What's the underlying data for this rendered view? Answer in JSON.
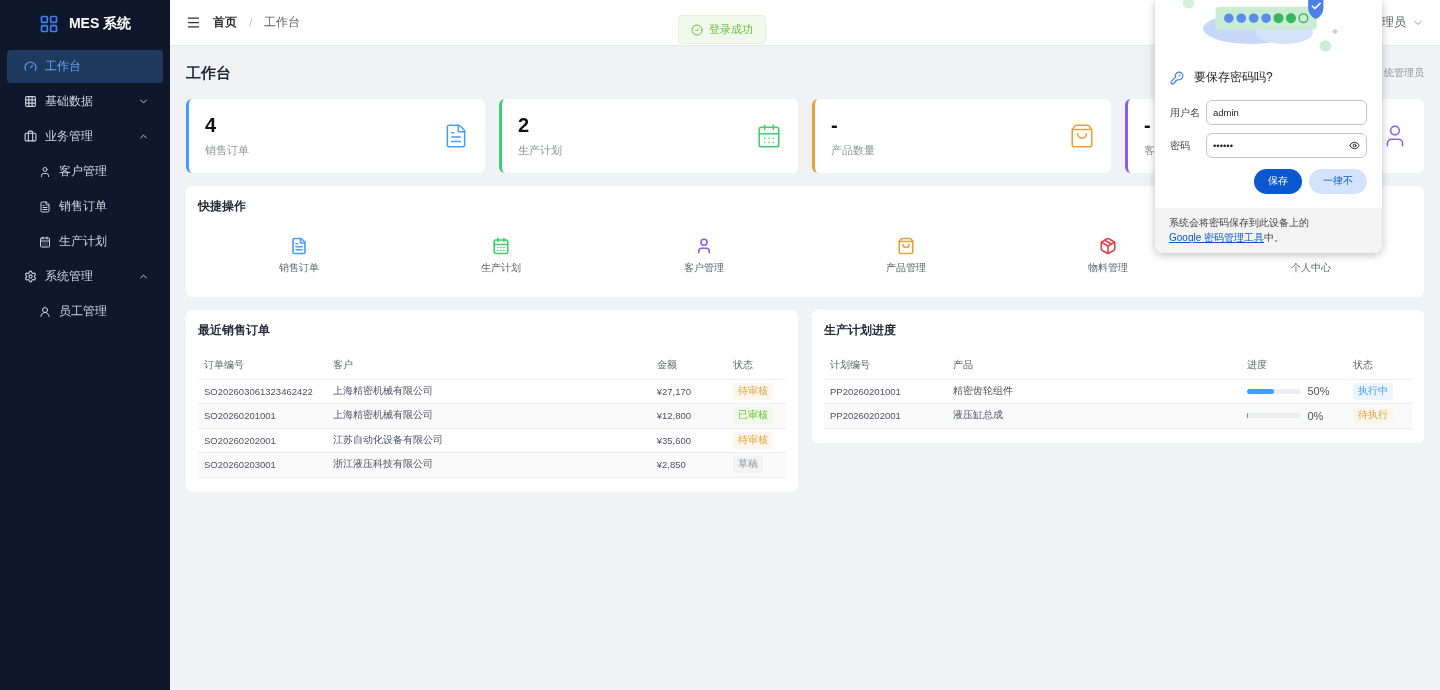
{
  "sidebar": {
    "logo": "MES 系统",
    "items": [
      {
        "label": "工作台",
        "selected": true
      },
      {
        "label": "基础数据",
        "selected": false,
        "expanded": false
      },
      {
        "label": "业务管理",
        "selected": false,
        "expanded": true,
        "children": [
          {
            "label": "客户管理",
            "selected": false
          },
          {
            "label": "销售订单",
            "selected": false
          },
          {
            "label": "生产计划",
            "selected": false
          }
        ]
      },
      {
        "label": "系统管理",
        "selected": false,
        "expanded": true,
        "children": [
          {
            "label": "员工管理",
            "selected": false
          }
        ]
      }
    ]
  },
  "header": {
    "breadcrumb": [
      "首页",
      "工作台"
    ],
    "separator": "/",
    "user": "理员"
  },
  "toast": {
    "text": "登录成功"
  },
  "page": {
    "title": "工作台",
    "welcome": "统管理员"
  },
  "stats": [
    {
      "value": "4",
      "label": "销售订单",
      "color": "#4a9ff5"
    },
    {
      "value": "2",
      "label": "生产计划",
      "color": "#3ecf6e"
    },
    {
      "value": "-",
      "label": "产品数量",
      "color": "#e6a23c"
    },
    {
      "value": "-",
      "label": "客",
      "color": "#8b5cf6"
    }
  ],
  "quick_actions": {
    "title": "快捷操作",
    "items": [
      {
        "label": "销售订单",
        "color": "#4a9ff5"
      },
      {
        "label": "生产计划",
        "color": "#3ecf6e"
      },
      {
        "label": "客户管理",
        "color": "#8b5cf6"
      },
      {
        "label": "产品管理",
        "color": "#e6a23c"
      },
      {
        "label": "物料管理",
        "color": "#e0454f"
      },
      {
        "label": "个人中心"
      }
    ]
  },
  "recent_orders": {
    "title": "最近销售订单",
    "columns": [
      "订单编号",
      "客户",
      "金额",
      "状态"
    ],
    "rows": [
      {
        "id": "SO202603061323462422",
        "customer": "上海精密机械有限公司",
        "amount": "¥27,170",
        "status": "待审核",
        "kind": "warning"
      },
      {
        "id": "SO20260201001",
        "customer": "上海精密机械有限公司",
        "amount": "¥12,800",
        "status": "已审核",
        "kind": "success"
      },
      {
        "id": "SO20260202001",
        "customer": "江苏自动化设备有限公司",
        "amount": "¥35,600",
        "status": "待审核",
        "kind": "warning"
      },
      {
        "id": "SO20260203001",
        "customer": "浙江液压科技有限公司",
        "amount": "¥2,850",
        "status": "草稿",
        "kind": "info"
      }
    ]
  },
  "plan_progress": {
    "title": "生产计划进度",
    "columns": [
      "计划编号",
      "产品",
      "进度",
      "状态"
    ],
    "rows": [
      {
        "id": "PP20260201001",
        "product": "精密齿轮组件",
        "level": 0.5,
        "percent": "50%",
        "status": "执行中",
        "kind": "primary"
      },
      {
        "id": "PP20260202001",
        "product": "液压缸总成",
        "level": 0,
        "percent": "0%",
        "status": "待执行",
        "kind": "warning"
      }
    ]
  },
  "password_prompt": {
    "title": "要保存密码吗?",
    "username_label": "用户名",
    "username": "admin",
    "password_label": "密码",
    "password": "••••••",
    "buttons": [
      "保存",
      "一律不"
    ],
    "footer": "系统会将密码保存到此设备上的 ",
    "link": "Google 密码管理工具",
    "footer_end": "中。"
  }
}
